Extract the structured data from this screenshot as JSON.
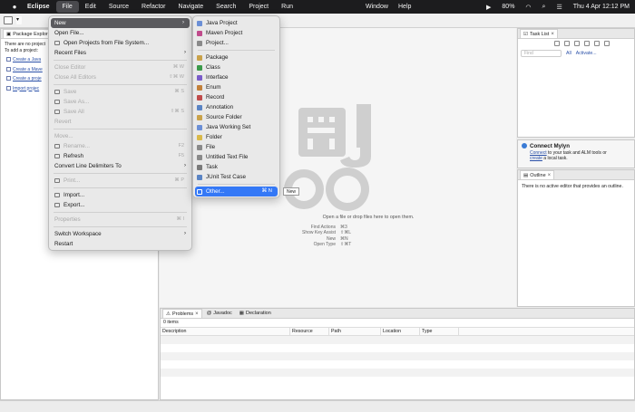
{
  "menubar": {
    "app": "Eclipse",
    "items": [
      "File",
      "Edit",
      "Source",
      "Refactor",
      "Navigate",
      "Search",
      "Project",
      "Run"
    ],
    "window": "Window",
    "help": "Help",
    "battery": "80%",
    "clock": "Thu 4 Apr  12:12 PM"
  },
  "package_explorer": {
    "tab": "Package Explorer",
    "line1": "There are no project",
    "line2": "To add a project:",
    "links": [
      "Create a Java",
      "Create a Mave",
      "Create a proje",
      "Import projec"
    ]
  },
  "file_menu": {
    "new": "New",
    "open_file": "Open File...",
    "open_projects": "Open Projects from File System...",
    "recent": "Recent Files",
    "close_editor": "Close Editor",
    "close_editor_sc": "⌘ W",
    "close_all": "Close All Editors",
    "close_all_sc": "⇧⌘ W",
    "save": "Save",
    "save_sc": "⌘ S",
    "save_as": "Save As...",
    "save_all": "Save All",
    "save_all_sc": "⇧⌘ S",
    "revert": "Revert",
    "move": "Move...",
    "rename": "Rename...",
    "rename_sc": "F2",
    "refresh": "Refresh",
    "refresh_sc": "F5",
    "convert": "Convert Line Delimiters To",
    "print": "Print...",
    "print_sc": "⌘ P",
    "import": "Import...",
    "export": "Export...",
    "properties": "Properties",
    "properties_sc": "⌘ I",
    "switch_ws": "Switch Workspace",
    "restart": "Restart"
  },
  "new_menu": {
    "items": [
      {
        "label": "Java Project",
        "color": "#6b8fd6"
      },
      {
        "label": "Maven Project",
        "color": "#c04b8c"
      },
      {
        "label": "Project...",
        "color": "#8a8a8a"
      },
      {
        "label": "Package",
        "color": "#c9a24a"
      },
      {
        "label": "Class",
        "color": "#3b9a4a"
      },
      {
        "label": "Interface",
        "color": "#7a5cc9"
      },
      {
        "label": "Enum",
        "color": "#c2803a"
      },
      {
        "label": "Record",
        "color": "#c04b4b"
      },
      {
        "label": "Annotation",
        "color": "#5a84c4"
      },
      {
        "label": "Source Folder",
        "color": "#c9a24a"
      },
      {
        "label": "Java Working Set",
        "color": "#6b8fd6"
      },
      {
        "label": "Folder",
        "color": "#d9b94a"
      },
      {
        "label": "File",
        "color": "#8a8a8a"
      },
      {
        "label": "Untitled Text File",
        "color": "#8a8a8a"
      },
      {
        "label": "Task",
        "color": "#7a7a7a"
      },
      {
        "label": "JUnit Test Case",
        "color": "#5a84c4"
      }
    ],
    "other": "Other...",
    "other_sc": "⌘ N",
    "tooltip": "New"
  },
  "editor": {
    "hint": "Open a file or drop files here to open them.",
    "shortcuts": [
      {
        "label": "Find Actions",
        "key": "⌘3"
      },
      {
        "label": "Show Key Assist",
        "key": "⇧⌘L"
      },
      {
        "label": "New",
        "key": "⌘N"
      },
      {
        "label": "Open Type",
        "key": "⇧⌘T"
      }
    ]
  },
  "task_list": {
    "tab": "Task List",
    "find_placeholder": "Find",
    "all": "All",
    "activate": "Activate..."
  },
  "mylyn": {
    "title": "Connect Mylyn",
    "connect": "Connect",
    "text1": " to your task and ALM tools or",
    "create": "create",
    "text2": " a local task."
  },
  "outline": {
    "tab": "Outline",
    "message": "There is no active editor that provides an outline."
  },
  "problems": {
    "tabs": [
      "Problems",
      "Javadoc",
      "Declaration"
    ],
    "count": "0 items",
    "columns": [
      "Description",
      "Resource",
      "Path",
      "Location",
      "Type"
    ]
  }
}
